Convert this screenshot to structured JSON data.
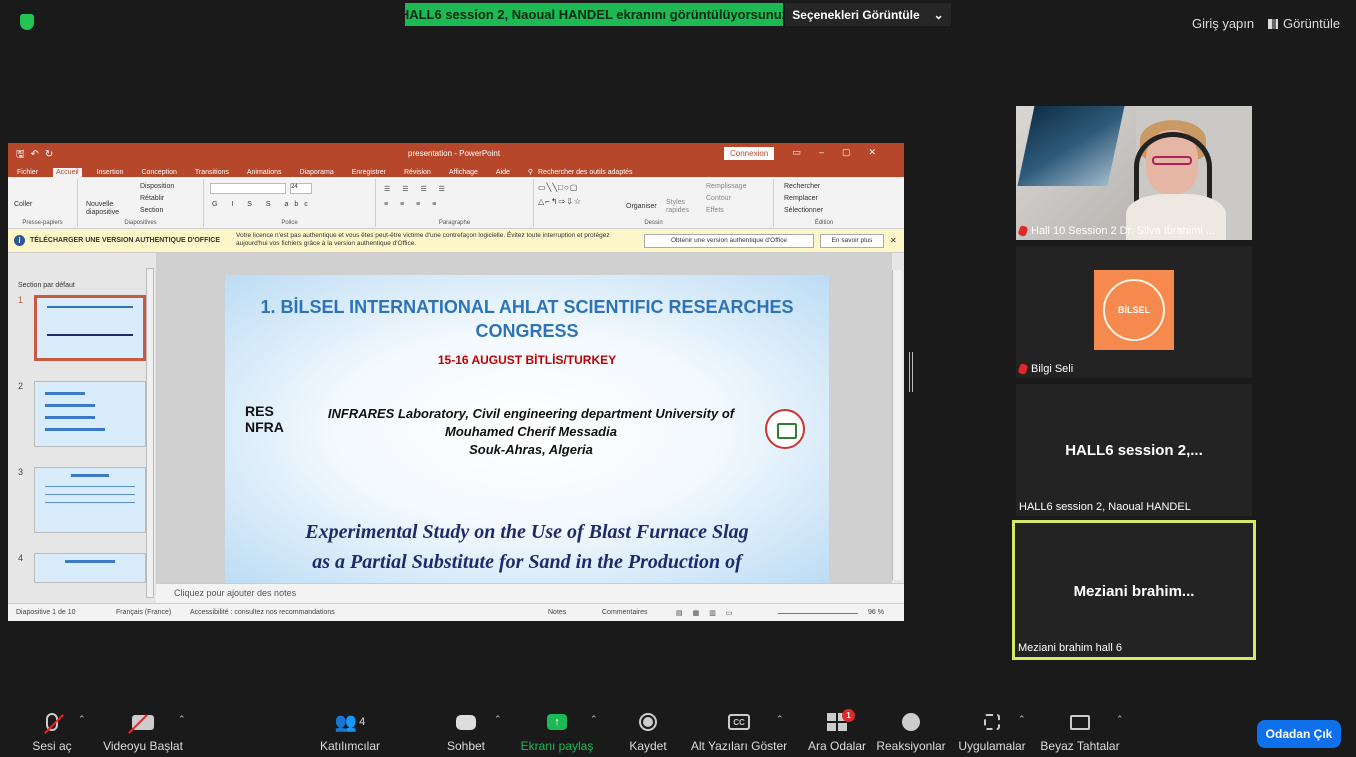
{
  "meeting": {
    "share_banner": "HALL6 session 2, Naoual HANDEL ekranını görüntülüyorsunuz",
    "view_options": "Seçenekleri Görüntüle",
    "sign_in": "Giriş yapın",
    "view": "Görüntüle",
    "accent": "#1db954",
    "leave_color": "#0e71eb"
  },
  "ppt": {
    "doc_title": "presentation - PowerPoint",
    "connect": "Connexion",
    "tabs": [
      "Fichier",
      "Accueil",
      "Insertion",
      "Conception",
      "Transitions",
      "Animations",
      "Diaporama",
      "Enregistrer",
      "Révision",
      "Affichage",
      "Aide"
    ],
    "search_tools": "Rechercher des outils adaptés",
    "ribbon": {
      "paste": "Coller",
      "new_slide": "Nouvelle diapositive",
      "layout": "Disposition",
      "reset": "Rétablir",
      "section": "Section",
      "font_size": "24",
      "arrange": "Organiser",
      "styles": "Styles rapides",
      "fill": "Remplissage",
      "outline": "Contour",
      "effects": "Effets",
      "find": "Rechercher",
      "replace": "Remplacer",
      "select": "Sélectionner",
      "groups": [
        "Presse-papiers",
        "Diapositives",
        "Police",
        "Paragraphe",
        "Dessin",
        "Édition"
      ]
    },
    "warning": {
      "heading": "TÉLÉCHARGER UNE VERSION AUTHENTIQUE D'OFFICE",
      "message": "Votre licence n'est pas authentique et vous êtes peut-être victime d'une contrefaçon logicielle. Évitez toute interruption et protégez aujourd'hui vos fichiers grâce à la version authentique d'Office.",
      "get_button": "Obtenir une version authentique d'Office",
      "learn_more": "En savoir plus"
    },
    "section_label": "Section par défaut",
    "thumb_numbers": [
      "1",
      "2",
      "3",
      "4"
    ],
    "slide": {
      "title": "1. BİLSEL INTERNATIONAL AHLAT SCIENTIFIC RESEARCHES CONGRESS",
      "date": "15-16 AUGUST BİTLİS/TURKEY",
      "lab_line1": "INFRARES Laboratory, Civil engineering department University of",
      "lab_line2": "Mouhamed Cherif Messadia",
      "lab_line3": "Souk-Ahras, Algeria",
      "logo_text_1": "RES",
      "logo_text_2": "NFRA",
      "study_line1": "Experimental Study on the Use of Blast Furnace Slag",
      "study_line2": "as a Partial Substitute for Sand in the Production of"
    },
    "notes_placeholder": "Cliquez pour ajouter des notes",
    "status": {
      "slide_count": "Diapositive 1 de 10",
      "language": "Français (France)",
      "accessibility": "Accessibilité : consultez nos recommandations",
      "notes": "Notes",
      "comments": "Commentaires",
      "zoom": "96 %"
    }
  },
  "gallery": [
    {
      "name": "Hall 10 Session 2 Dr. Silva Ibrahimi ..."
    },
    {
      "name": "Bilgi Seli",
      "logo_text": "BİLSEL"
    },
    {
      "name": "HALL6 session 2, Naoual HANDEL",
      "big": "HALL6 session 2,..."
    },
    {
      "name": "Meziani brahim hall 6",
      "big": "Meziani brahim..."
    }
  ],
  "toolbar": {
    "unmute": "Sesi aç",
    "start_video": "Videoyu Başlat",
    "participants": "Katılımcılar",
    "participants_count": "4",
    "chat": "Sohbet",
    "share_screen": "Ekranı paylaş",
    "record": "Kaydet",
    "captions": "Alt Yazıları Göster",
    "captions_icon": "CC",
    "breakout": "Ara Odalar",
    "breakout_badge": "1",
    "reactions": "Reaksiyonlar",
    "apps": "Uygulamalar",
    "whiteboard": "Beyaz Tahtalar",
    "leave": "Odadan Çık"
  }
}
